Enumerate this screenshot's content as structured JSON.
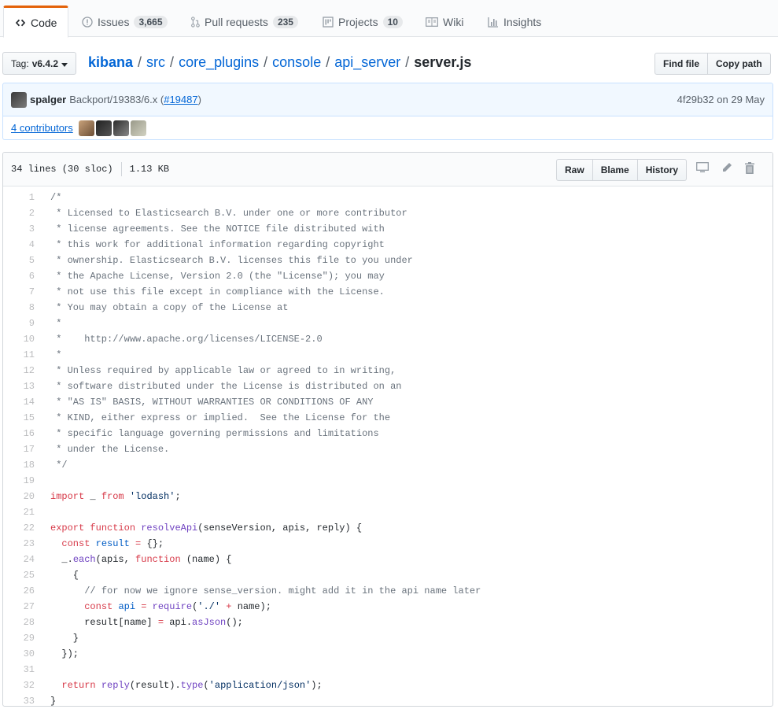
{
  "tabs": [
    {
      "label": "Code",
      "icon": "code-icon",
      "count": null,
      "active": true
    },
    {
      "label": "Issues",
      "icon": "issue-icon",
      "count": "3,665"
    },
    {
      "label": "Pull requests",
      "icon": "pull-request-icon",
      "count": "235"
    },
    {
      "label": "Projects",
      "icon": "project-icon",
      "count": "10"
    },
    {
      "label": "Wiki",
      "icon": "book-icon",
      "count": null
    },
    {
      "label": "Insights",
      "icon": "graph-icon",
      "count": null
    }
  ],
  "branch": {
    "prefix": "Tag:",
    "name": "v6.4.2"
  },
  "breadcrumb": {
    "repo": "kibana",
    "parts": [
      "src",
      "core_plugins",
      "console",
      "api_server"
    ],
    "file": "server.js",
    "separator": "/"
  },
  "buttons": {
    "find_file": "Find file",
    "copy_path": "Copy path"
  },
  "commit": {
    "author": "spalger",
    "message": "Backport/19383/6.x (",
    "pr": "#19487",
    "message_end": ")",
    "sha": "4f29b32",
    "date": "on 29 May"
  },
  "contributors": {
    "label": "4 contributors"
  },
  "file": {
    "lines_info": "34 lines (30 sloc)",
    "size": "1.13 KB",
    "raw_label": "Raw",
    "blame_label": "Blame",
    "history_label": "History"
  },
  "code_lines": [
    "/*",
    " * Licensed to Elasticsearch B.V. under one or more contributor",
    " * license agreements. See the NOTICE file distributed with",
    " * this work for additional information regarding copyright",
    " * ownership. Elasticsearch B.V. licenses this file to you under",
    " * the Apache License, Version 2.0 (the \"License\"); you may",
    " * not use this file except in compliance with the License.",
    " * You may obtain a copy of the License at",
    " *",
    " *    http://www.apache.org/licenses/LICENSE-2.0",
    " *",
    " * Unless required by applicable law or agreed to in writing,",
    " * software distributed under the License is distributed on an",
    " * \"AS IS\" BASIS, WITHOUT WARRANTIES OR CONDITIONS OF ANY",
    " * KIND, either express or implied.  See the License for the",
    " * specific language governing permissions and limitations",
    " * under the License.",
    " */",
    "",
    "import _ from 'lodash';",
    "",
    "export function resolveApi(senseVersion, apis, reply) {",
    "  const result = {};",
    "  _.each(apis, function (name) {",
    "    {",
    "      // for now we ignore sense_version. might add it in the api name later",
    "      const api = require('./' + name);",
    "      result[name] = api.asJson();",
    "    }",
    "  });",
    "",
    "  return reply(result).type('application/json');",
    "}"
  ],
  "colors": {
    "link": "#0366d6",
    "keyword": "#d73a49",
    "string": "#032f62",
    "function": "#6f42c1",
    "variable": "#005cc5",
    "comment": "#6a737d",
    "active_tab_accent": "#e36209"
  }
}
